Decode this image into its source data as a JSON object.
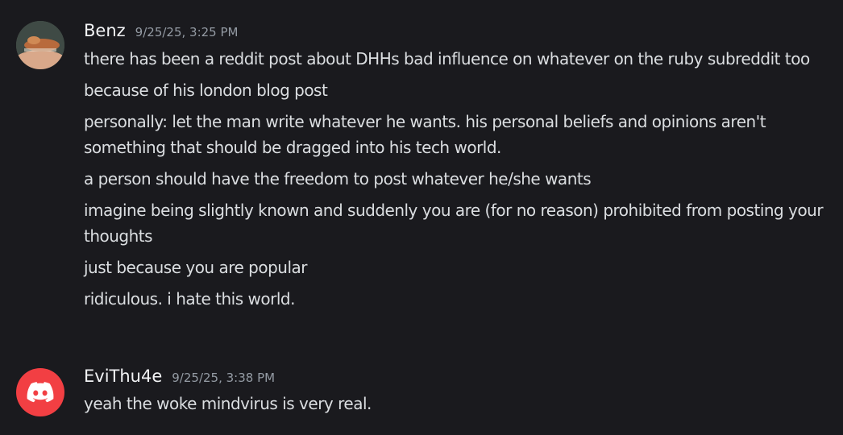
{
  "messages": [
    {
      "username": "Benz",
      "timestamp": "9/25/25, 3:25 PM",
      "avatar_icon": "user-photo-avatar",
      "lines": [
        "there has been a reddit post about DHHs bad influence on whatever on the ruby subreddit too",
        "because of his london blog post",
        "personally: let the man write whatever he wants. his personal beliefs and opinions aren't something that should be dragged into his tech world.",
        "a person should have the freedom to post whatever he/she wants",
        "imagine being slightly known and suddenly you are (for no reason) prohibited from posting your thoughts",
        "just because you are popular",
        "ridiculous. i hate this world."
      ]
    },
    {
      "username": "EviThu4e",
      "timestamp": "9/25/25, 3:38 PM",
      "avatar_icon": "discord-logo-icon",
      "avatar_color": "#f23f43",
      "lines": [
        "yeah the woke mindvirus is very real."
      ]
    }
  ],
  "colors": {
    "background": "#1a1a1e",
    "text": "#dbdee1",
    "username": "#f2f3f5",
    "timestamp": "#949ba4"
  }
}
